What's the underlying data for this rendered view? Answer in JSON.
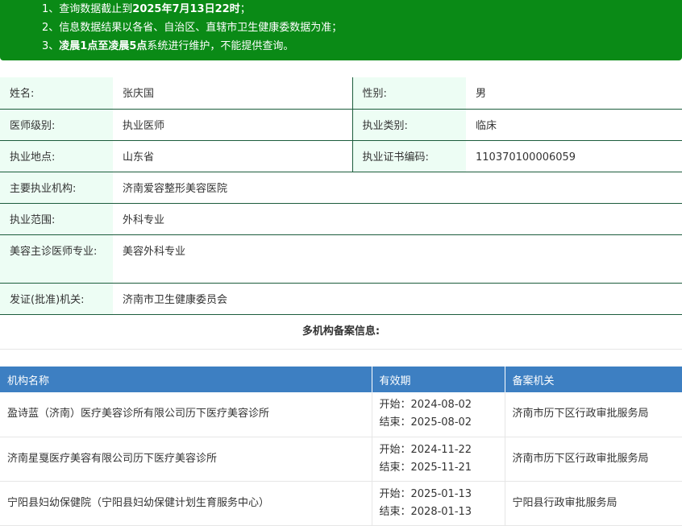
{
  "notice": {
    "line1_prefix": "1、查询数据截止到",
    "line1_bold": "2025年7月13日22时",
    "line1_suffix": "；",
    "line2": "2、信息数据结果以各省、自治区、直辖市卫生健康委数据为准；",
    "line3_prefix": "3、",
    "line3_bold": "凌晨1点至凌晨5点",
    "line3_suffix": "系统进行维护，不能提供查询。"
  },
  "info": {
    "name_label": "姓名:",
    "name_value": "张庆国",
    "gender_label": "性别:",
    "gender_value": "男",
    "level_label": "医师级别:",
    "level_value": "执业医师",
    "category_label": "执业类别:",
    "category_value": "临床",
    "location_label": "执业地点:",
    "location_value": "山东省",
    "cert_label": "执业证书编码:",
    "cert_value": "110370100006059",
    "institution_label": "主要执业机构:",
    "institution_value": "济南爱容整形美容医院",
    "scope_label": "执业范围:",
    "scope_value": "外科专业",
    "cosmetic_label": "美容主诊医师专业:",
    "cosmetic_value": "美容外科专业",
    "authority_label": "发证(批准)机关:",
    "authority_value": "济南市卫生健康委员会"
  },
  "multi_title": "多机构备案信息:",
  "records": {
    "headers": {
      "name": "机构名称",
      "validity": "有效期",
      "authority": "备案机关"
    },
    "rows": [
      {
        "name": "盈诗蓝（济南）医疗美容诊所有限公司历下医疗美容诊所",
        "start": "开始：2024-08-02",
        "end": "结束：2025-08-02",
        "authority": "济南市历下区行政审批服务局"
      },
      {
        "name": "济南星戛医疗美容有限公司历下医疗美容诊所",
        "start": "开始：2024-11-22",
        "end": "结束：2025-11-21",
        "authority": "济南市历下区行政审批服务局"
      },
      {
        "name": "宁阳县妇幼保健院（宁阳县妇幼保健计划生育服务中心）",
        "start": "开始：2025-01-13",
        "end": "结束：2028-01-13",
        "authority": "宁阳县行政审批服务局"
      }
    ]
  }
}
